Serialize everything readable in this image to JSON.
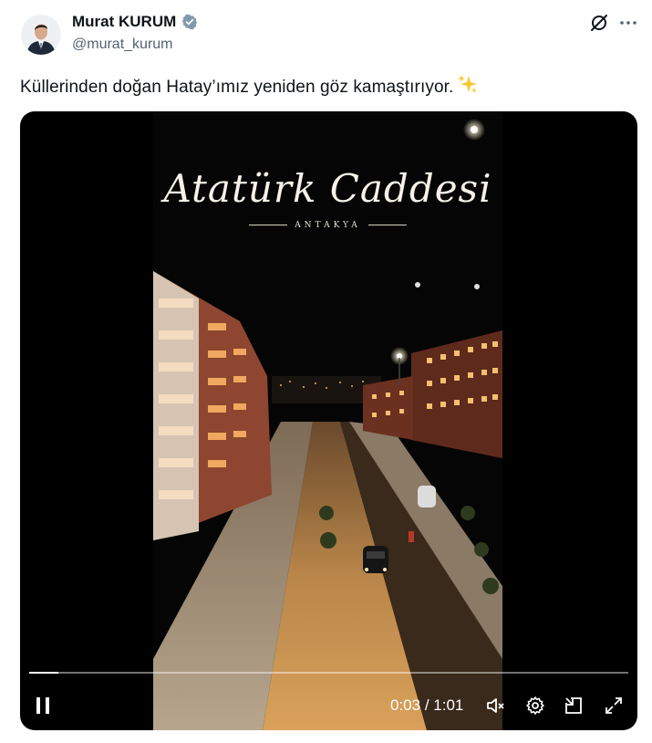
{
  "author": {
    "display_name": "Murat KURUM",
    "handle": "@murat_kurum",
    "verified_color": "#829aab"
  },
  "tweet": {
    "text": "Küllerinden doğan Hatay’ımız yeniden göz kamaştırıyor.",
    "emoji": "sparkles"
  },
  "video": {
    "title_script": "Atatürk Caddesi",
    "subtitle": "ANTAKYA",
    "current_time": "0:03",
    "separator": " / ",
    "duration": "1:01",
    "progress_fraction": 0.049,
    "controls": [
      "pause-icon",
      "mute-icon",
      "settings-icon",
      "pip-icon",
      "fullscreen-icon"
    ]
  },
  "colors": {
    "text_primary": "#0f1419",
    "text_secondary": "#536471",
    "video_bg": "#000000",
    "building": "#a8553a",
    "street_glow": "#d9a15a"
  }
}
